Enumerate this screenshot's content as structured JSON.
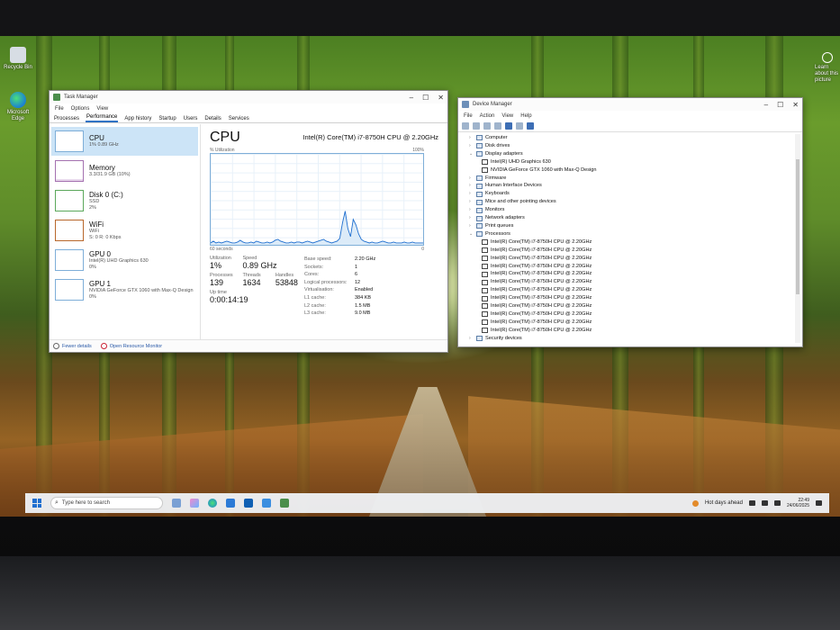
{
  "desktop": {
    "icons": [
      {
        "label": "Recycle Bin",
        "icon": "recycle-bin-icon"
      },
      {
        "label": "Microsoft Edge",
        "icon": "edge-icon"
      }
    ],
    "overlay_text": "Learn about this picture"
  },
  "task_manager": {
    "title": "Task Manager",
    "menu": [
      "File",
      "Options",
      "View"
    ],
    "tabs": [
      "Processes",
      "Performance",
      "App history",
      "Startup",
      "Users",
      "Details",
      "Services"
    ],
    "active_tab": "Performance",
    "sidebar": [
      {
        "name": "CPU",
        "sub": "1% 0.89 GHz"
      },
      {
        "name": "Memory",
        "sub": "3.3/31.9 GB (10%)"
      },
      {
        "name": "Disk 0 (C:)",
        "sub": "SSD",
        "sub2": "2%"
      },
      {
        "name": "WiFi",
        "sub": "WiFi",
        "sub2": "S: 0 R: 0 Kbps"
      },
      {
        "name": "GPU 0",
        "sub": "Intel(R) UHD Graphics 630",
        "sub2": "0%"
      },
      {
        "name": "GPU 1",
        "sub": "NVIDIA GeForce GTX 1060 with Max-Q Design",
        "sub2": "0%"
      }
    ],
    "main": {
      "title": "CPU",
      "model": "Intel(R) Core(TM) i7-8750H CPU @ 2.20GHz",
      "util_label": "% Utilization",
      "util_max": "100%",
      "time_left": "60 seconds",
      "time_right": "0",
      "stats": {
        "utilization_label": "Utilization",
        "utilization": "1%",
        "speed_label": "Speed",
        "speed": "0.89 GHz",
        "processes_label": "Processes",
        "processes": "139",
        "threads_label": "Threads",
        "threads": "1634",
        "handles_label": "Handles",
        "handles": "53848",
        "uptime_label": "Up time",
        "uptime": "0:00:14:19"
      },
      "specs": [
        {
          "k": "Base speed:",
          "v": "2.20 GHz"
        },
        {
          "k": "Sockets:",
          "v": "1"
        },
        {
          "k": "Cores:",
          "v": "6"
        },
        {
          "k": "Logical processors:",
          "v": "12"
        },
        {
          "k": "Virtualisation:",
          "v": "Enabled"
        },
        {
          "k": "L1 cache:",
          "v": "384 KB"
        },
        {
          "k": "L2 cache:",
          "v": "1.5 MB"
        },
        {
          "k": "L3 cache:",
          "v": "9.0 MB"
        }
      ],
      "cpu_history": [
        2,
        4,
        2,
        3,
        2,
        3,
        4,
        3,
        2,
        2,
        3,
        5,
        3,
        2,
        2,
        3,
        2,
        4,
        3,
        2,
        2,
        3,
        2,
        3,
        5,
        6,
        4,
        3,
        2,
        2,
        3,
        2,
        3,
        3,
        2,
        3,
        4,
        3,
        2,
        3,
        4,
        5,
        6,
        4,
        3,
        2,
        3,
        4,
        7,
        24,
        37,
        18,
        9,
        28,
        22,
        12,
        6,
        4,
        3,
        2,
        3,
        2,
        2,
        3,
        4,
        3,
        2,
        2,
        3,
        2,
        2,
        2,
        3,
        2,
        2,
        3,
        2,
        2,
        2,
        2
      ]
    },
    "footer": {
      "fewer": "Fewer details",
      "open_monitor": "Open Resource Monitor"
    }
  },
  "device_manager": {
    "title": "Device Manager",
    "menu": [
      "File",
      "Action",
      "View",
      "Help"
    ],
    "tree": [
      {
        "label": "Computer",
        "level": 0,
        "expanded": false
      },
      {
        "label": "Disk drives",
        "level": 0,
        "expanded": false
      },
      {
        "label": "Display adapters",
        "level": 0,
        "expanded": true
      },
      {
        "label": "Intel(R) UHD Graphics 630",
        "level": 1
      },
      {
        "label": "NVIDIA GeForce GTX 1060 with Max-Q Design",
        "level": 1
      },
      {
        "label": "Firmware",
        "level": 0,
        "expanded": false
      },
      {
        "label": "Human Interface Devices",
        "level": 0,
        "expanded": false
      },
      {
        "label": "Keyboards",
        "level": 0,
        "expanded": false
      },
      {
        "label": "Mice and other pointing devices",
        "level": 0,
        "expanded": false
      },
      {
        "label": "Monitors",
        "level": 0,
        "expanded": false
      },
      {
        "label": "Network adapters",
        "level": 0,
        "expanded": false
      },
      {
        "label": "Print queues",
        "level": 0,
        "expanded": false
      },
      {
        "label": "Processors",
        "level": 0,
        "expanded": true
      },
      {
        "label": "Intel(R) Core(TM) i7-8750H CPU @ 2.20GHz",
        "level": 1
      },
      {
        "label": "Intel(R) Core(TM) i7-8750H CPU @ 2.20GHz",
        "level": 1
      },
      {
        "label": "Intel(R) Core(TM) i7-8750H CPU @ 2.20GHz",
        "level": 1
      },
      {
        "label": "Intel(R) Core(TM) i7-8750H CPU @ 2.20GHz",
        "level": 1
      },
      {
        "label": "Intel(R) Core(TM) i7-8750H CPU @ 2.20GHz",
        "level": 1
      },
      {
        "label": "Intel(R) Core(TM) i7-8750H CPU @ 2.20GHz",
        "level": 1
      },
      {
        "label": "Intel(R) Core(TM) i7-8750H CPU @ 2.20GHz",
        "level": 1
      },
      {
        "label": "Intel(R) Core(TM) i7-8750H CPU @ 2.20GHz",
        "level": 1
      },
      {
        "label": "Intel(R) Core(TM) i7-8750H CPU @ 2.20GHz",
        "level": 1
      },
      {
        "label": "Intel(R) Core(TM) i7-8750H CPU @ 2.20GHz",
        "level": 1
      },
      {
        "label": "Intel(R) Core(TM) i7-8750H CPU @ 2.20GHz",
        "level": 1
      },
      {
        "label": "Intel(R) Core(TM) i7-8750H CPU @ 2.20GHz",
        "level": 1
      },
      {
        "label": "Security devices",
        "level": 0,
        "expanded": false
      }
    ]
  },
  "taskbar": {
    "search_placeholder": "Type here to search",
    "weather": "Hot days ahead",
    "time": "22:49",
    "date": "24/06/2025",
    "apps": [
      "widgets",
      "copilot",
      "edge",
      "mail",
      "outlook",
      "store",
      "task-manager"
    ]
  },
  "colors": {
    "accent": "#1f6fd0",
    "cpu_line": "#1f6fd0",
    "selected": "#cce4f7"
  }
}
